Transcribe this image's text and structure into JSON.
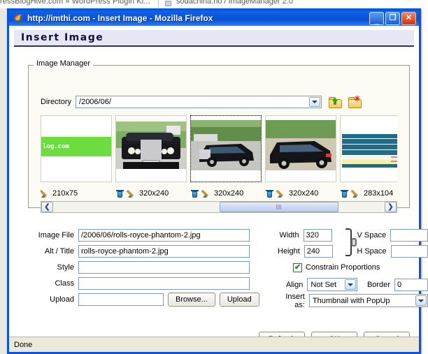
{
  "background": {
    "tab1_title": "ressBlogHive.com » WordPress Plugin Ki...",
    "tab2_title": "sodachina.no / ImageManager 2.0"
  },
  "window": {
    "title_url": "http://imthi.com",
    "title_rest": "- Insert Image - Mozilla Firefox",
    "icon": "firefox-icon",
    "minimize_label": "_",
    "maximize_label": "❐",
    "close_label": "✕"
  },
  "page": {
    "heading": "Insert Image"
  },
  "image_manager": {
    "legend": "Image Manager",
    "directory_label": "Directory",
    "directory_value": "/2006/06/",
    "parent_folder_icon": "folder-up-icon",
    "new_folder_icon": "folder-new-icon",
    "thumbnails": [
      {
        "art": "banner",
        "caption": "210x75",
        "banner_text": "log.com",
        "has_delete": false,
        "selected": false
      },
      {
        "art": "car-front",
        "caption": "320x240",
        "has_delete": true,
        "selected": false
      },
      {
        "art": "car-angle",
        "caption": "320x240",
        "has_delete": true,
        "selected": true
      },
      {
        "art": "car-side",
        "caption": "320x240",
        "has_delete": true,
        "selected": false
      },
      {
        "art": "stats",
        "caption": "283x104",
        "has_delete": true,
        "selected": false
      },
      {
        "art": "stats",
        "caption": "",
        "has_delete": true,
        "selected": false
      }
    ],
    "scroll_left_label": "❮",
    "scroll_right_label": "❯"
  },
  "form": {
    "image_file_label": "Image File",
    "image_file_value": "/2006/06/rolls-royce-phantom-2.jpg",
    "alt_title_label": "Alt / Title",
    "alt_title_value": "rolls-royce-phantom-2.jpg",
    "style_label": "Style",
    "style_value": "",
    "class_label": "Class",
    "class_value": "",
    "upload_label": "Upload",
    "upload_value": "",
    "browse_button": "Browse...",
    "upload_button": "Upload",
    "width_label": "Width",
    "width_value": "320",
    "height_label": "Height",
    "height_value": "240",
    "vspace_label": "V Space",
    "vspace_value": "",
    "hspace_label": "H Space",
    "hspace_value": "",
    "constrain_label": "Constrain Proportions",
    "constrain_checked": "✔",
    "align_label": "Align",
    "align_value": "Not Set",
    "border_label": "Border",
    "border_value": "0",
    "insert_as_label": "Insert as:",
    "insert_as_value": "Thumbnail with PopUp",
    "chain_icon": "chain-link-icon"
  },
  "buttons": {
    "refresh": "Refresh",
    "ok": "OK",
    "cancel": "Cancel"
  },
  "status": {
    "text": "Done"
  }
}
